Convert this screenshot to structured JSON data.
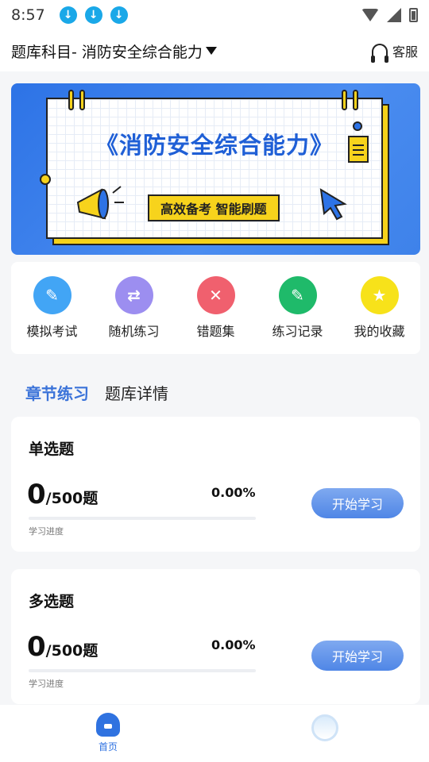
{
  "status_bar": {
    "time": "8:57",
    "download_icons": [
      "download-icon",
      "download-icon",
      "download-icon"
    ]
  },
  "header": {
    "subject_label": "题库科目- 消防安全综合能力",
    "service_label": "客服"
  },
  "banner": {
    "title": "《消防安全综合能力》",
    "tagline": "高效备考 智能刷题"
  },
  "menu": [
    {
      "label": "模拟考试",
      "icon": "exam-doc-icon",
      "color": "#42a5f5"
    },
    {
      "label": "随机练习",
      "icon": "shuffle-icon",
      "color": "#9c8ef0"
    },
    {
      "label": "错题集",
      "icon": "wrong-questions-icon",
      "color": "#f0606e"
    },
    {
      "label": "练习记录",
      "icon": "record-icon",
      "color": "#1fba6a"
    },
    {
      "label": "我的收藏",
      "icon": "star-icon",
      "color": "#f7e21a"
    }
  ],
  "tabs": {
    "active": "章节练习",
    "other": "题库详情"
  },
  "question_sets": [
    {
      "title": "单选题",
      "done": "0",
      "total": "/500题",
      "percent": "0.00%",
      "progress_label": "学习进度",
      "progress_fraction": 0,
      "button": "开始学习"
    },
    {
      "title": "多选题",
      "done": "0",
      "total": "/500题",
      "percent": "0.00%",
      "progress_label": "学习进度",
      "progress_fraction": 0,
      "button": "开始学习"
    }
  ],
  "bottom_nav": {
    "home_label": "首页"
  },
  "colors": {
    "accent": "#3b73d9",
    "banner_blue": "#2d73e6",
    "banner_yellow": "#f7d31c"
  }
}
